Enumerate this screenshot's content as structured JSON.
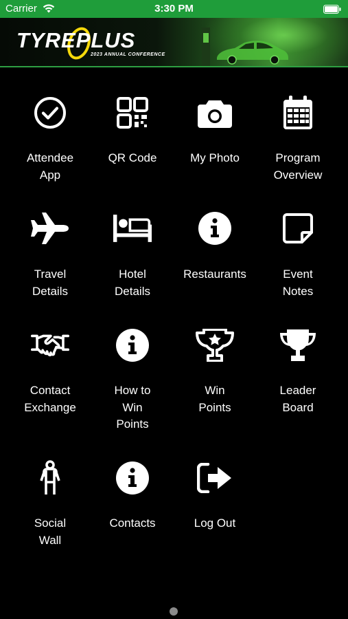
{
  "status_bar": {
    "carrier": "Carrier",
    "time": "3:30 PM",
    "wifi_icon": "wifi-icon",
    "battery_icon": "battery-icon",
    "background_color": "#1f9d3a"
  },
  "banner": {
    "logo_text": "TYREPLUS",
    "subtitle": "2023 ANNUAL CONFERENCE",
    "accent_color": "#2ea043"
  },
  "menu": [
    {
      "id": "attendee-app",
      "label": "Attendee\nApp",
      "icon": "check-circle-icon"
    },
    {
      "id": "qr-code",
      "label": "QR Code",
      "icon": "qr-code-icon"
    },
    {
      "id": "my-photo",
      "label": "My Photo",
      "icon": "camera-icon"
    },
    {
      "id": "program-overview",
      "label": "Program\nOverview",
      "icon": "calendar-icon"
    },
    {
      "id": "travel-details",
      "label": "Travel\nDetails",
      "icon": "plane-icon"
    },
    {
      "id": "hotel-details",
      "label": "Hotel\nDetails",
      "icon": "bed-icon"
    },
    {
      "id": "restaurants",
      "label": "Restaurants",
      "icon": "info-icon"
    },
    {
      "id": "event-notes",
      "label": "Event\nNotes",
      "icon": "sticky-note-icon"
    },
    {
      "id": "contact-exchange",
      "label": "Contact\nExchange",
      "icon": "handshake-icon"
    },
    {
      "id": "how-to-win-points",
      "label": "How to\nWin\nPoints",
      "icon": "info-icon"
    },
    {
      "id": "win-points",
      "label": "Win\nPoints",
      "icon": "trophy-star-icon"
    },
    {
      "id": "leader-board",
      "label": "Leader\nBoard",
      "icon": "trophy-icon"
    },
    {
      "id": "social-wall",
      "label": "Social\nWall",
      "icon": "person-icon"
    },
    {
      "id": "contacts",
      "label": "Contacts",
      "icon": "info-icon"
    },
    {
      "id": "log-out",
      "label": "Log Out",
      "icon": "sign-out-icon"
    }
  ],
  "pager": {
    "pages": 1,
    "current": 1
  }
}
